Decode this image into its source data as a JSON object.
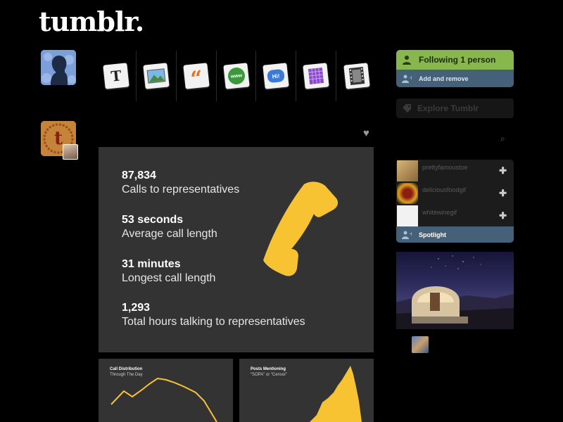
{
  "header": {
    "logo": "tumblr."
  },
  "post_types": [
    {
      "name": "text",
      "glyph": "T",
      "color": "#222222"
    },
    {
      "name": "photo",
      "glyph": "▲",
      "color": "#4a8a3a"
    },
    {
      "name": "quote",
      "glyph": "“",
      "color": "#e2741e"
    },
    {
      "name": "link",
      "glyph": "www",
      "color": "#3a9a3a"
    },
    {
      "name": "chat",
      "glyph": "Hi!",
      "color": "#3a7ad8"
    },
    {
      "name": "audio",
      "glyph": "▦",
      "color": "#8a4ac8"
    },
    {
      "name": "video",
      "glyph": "▤",
      "color": "#444444"
    }
  ],
  "post": {
    "stats": [
      {
        "value": "87,834",
        "label": "Calls to representatives"
      },
      {
        "value": "53 seconds",
        "label": "Average call length"
      },
      {
        "value": "31 minutes",
        "label": "Longest call length"
      },
      {
        "value": "1,293",
        "label": "Total hours talking to representatives"
      }
    ],
    "accent": "#f7c333"
  },
  "charts": {
    "a": {
      "title": "Call Distribution",
      "subtitle": "Through The Day"
    },
    "b": {
      "title": "Posts Mentioning",
      "subtitle": "“SOPA” or “Censor”"
    }
  },
  "sidebar": {
    "following": "Following 1 person",
    "add_remove": "Add and remove",
    "explore": "Explore Tumblr",
    "recommendations": [
      {
        "name": "prettyfamoustoe",
        "thumb_color": "#c8a468"
      },
      {
        "name": "deliciousfoodgif",
        "thumb_color": "#d8a020"
      },
      {
        "name": "whitewinegif",
        "thumb_color": "#f0f0f0"
      }
    ],
    "spotlight": "Spotlight"
  },
  "colors": {
    "follow_green": "#87b74d",
    "blue_bar": "#45617a"
  }
}
